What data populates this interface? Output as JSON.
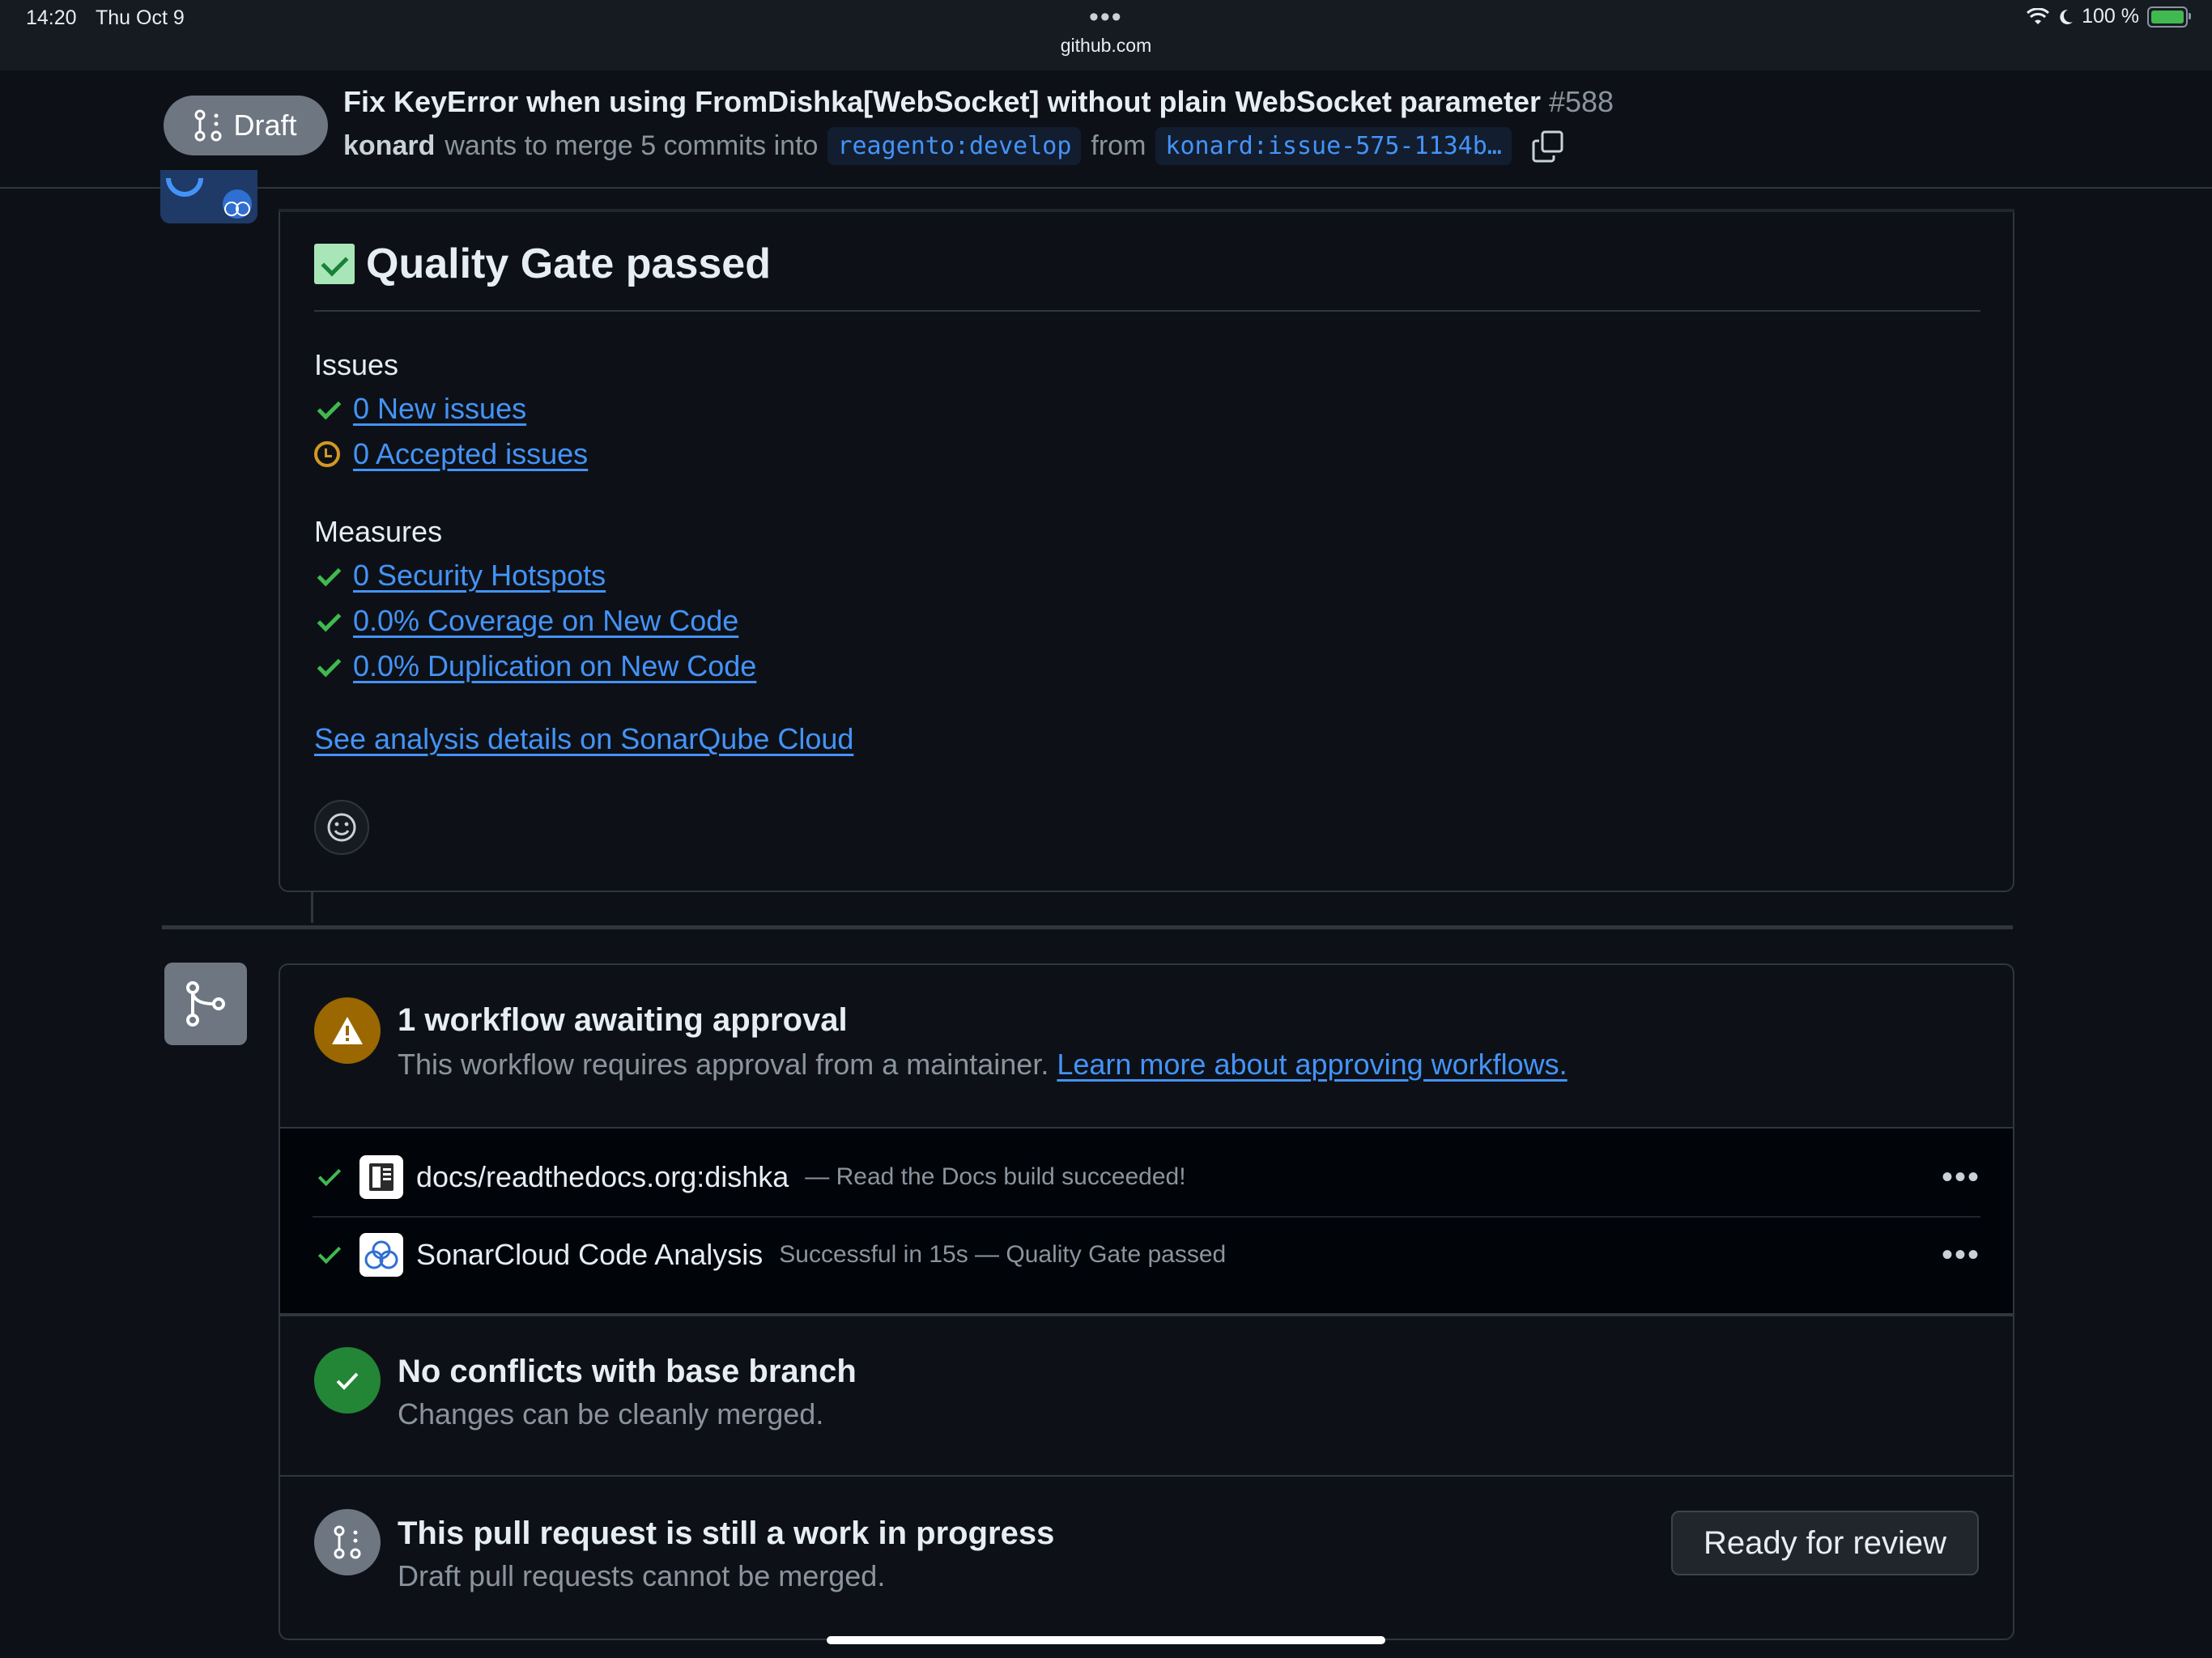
{
  "status_bar": {
    "time": "14:20",
    "date": "Thu Oct 9",
    "url": "github.com",
    "battery": "100 %"
  },
  "pr_header": {
    "draft_label": "Draft",
    "title": "Fix KeyError when using FromDishka[WebSocket] without plain WebSocket parameter",
    "number": "#588",
    "author": "konard",
    "merge_text_1": "wants to merge 5 commits into",
    "base_branch": "reagento:develop",
    "merge_text_2": "from",
    "head_branch": "konard:issue-575-1134b…"
  },
  "quality_gate": {
    "title": "Quality Gate passed",
    "issues_heading": "Issues",
    "new_issues": "0 New issues",
    "accepted_issues": "0 Accepted issues",
    "measures_heading": "Measures",
    "security_hotspots": "0 Security Hotspots",
    "coverage": "0.0% Coverage on New Code",
    "duplication": "0.0% Duplication on New Code",
    "details_link": "See analysis details on SonarQube Cloud"
  },
  "merge_box": {
    "workflow_title": "1 workflow awaiting approval",
    "workflow_desc": "This workflow requires approval from a maintainer.",
    "workflow_link": "Learn more about approving workflows.",
    "checks": [
      {
        "name": "docs/readthedocs.org:dishka",
        "desc": "— Read the Docs build succeeded!",
        "more": "•••"
      },
      {
        "name": "SonarCloud Code Analysis",
        "desc": "Successful in 15s — Quality Gate passed",
        "more": "•••"
      }
    ],
    "conflicts_title": "No conflicts with base branch",
    "conflicts_desc": "Changes can be cleanly merged.",
    "wip_title": "This pull request is still a work in progress",
    "wip_desc": "Draft pull requests cannot be merged.",
    "ready_button": "Ready for review"
  },
  "colors": {
    "background": "#0d1117",
    "link": "#4493f8",
    "success": "#3fb950",
    "warning": "#9a6700",
    "draft": "#6e7681"
  }
}
